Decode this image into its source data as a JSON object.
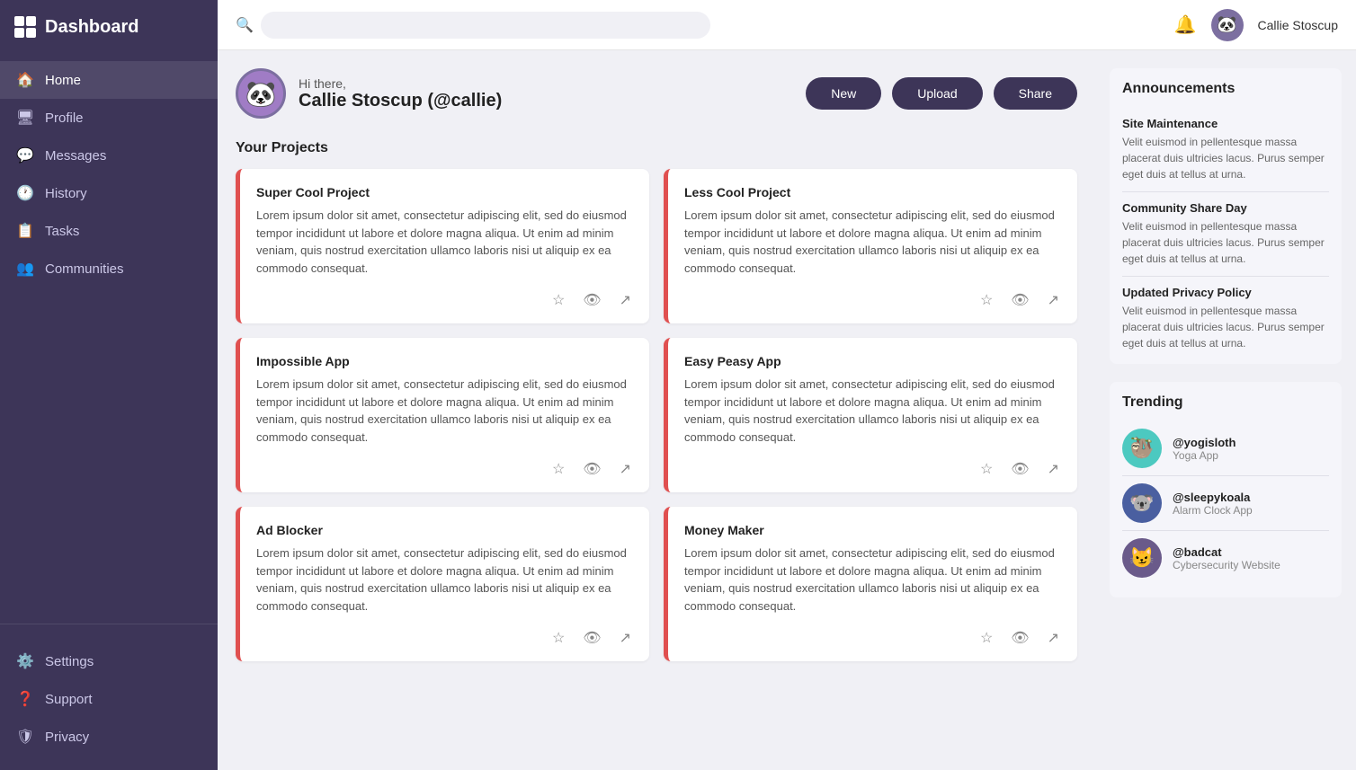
{
  "app": {
    "title": "Dashboard"
  },
  "sidebar": {
    "items_top": [
      {
        "id": "home",
        "label": "Home",
        "icon": "🏠"
      },
      {
        "id": "profile",
        "label": "Profile",
        "icon": "🖥"
      },
      {
        "id": "messages",
        "label": "Messages",
        "icon": "💬"
      },
      {
        "id": "history",
        "label": "History",
        "icon": "🕐"
      },
      {
        "id": "tasks",
        "label": "Tasks",
        "icon": "📋"
      },
      {
        "id": "communities",
        "label": "Communities",
        "icon": "👥"
      }
    ],
    "items_bottom": [
      {
        "id": "settings",
        "label": "Settings",
        "icon": "⚙️"
      },
      {
        "id": "support",
        "label": "Support",
        "icon": "❓"
      },
      {
        "id": "privacy",
        "label": "Privacy",
        "icon": "🛡"
      }
    ]
  },
  "header": {
    "search_placeholder": "",
    "notification_icon": "🔔",
    "user_name": "Callie Stoscup",
    "user_avatar": "🐼"
  },
  "greeting": {
    "hi_text": "Hi there,",
    "user_name": "Callie Stoscup (@callie)",
    "avatar": "🐼",
    "buttons": {
      "new": "New",
      "upload": "Upload",
      "share": "Share"
    }
  },
  "projects": {
    "heading": "Your Projects",
    "cards": [
      {
        "title": "Super Cool Project",
        "description": "Lorem ipsum dolor sit amet, consectetur adipiscing elit, sed do eiusmod tempor incididunt ut labore et dolore magna aliqua. Ut enim ad minim veniam, quis nostrud exercitation ullamco laboris nisi ut aliquip ex ea commodo consequat."
      },
      {
        "title": "Less Cool Project",
        "description": "Lorem ipsum dolor sit amet, consectetur adipiscing elit, sed do eiusmod tempor incididunt ut labore et dolore magna aliqua. Ut enim ad minim veniam, quis nostrud exercitation ullamco laboris nisi ut aliquip ex ea commodo consequat."
      },
      {
        "title": "Impossible App",
        "description": "Lorem ipsum dolor sit amet, consectetur adipiscing elit, sed do eiusmod tempor incididunt ut labore et dolore magna aliqua. Ut enim ad minim veniam, quis nostrud exercitation ullamco laboris nisi ut aliquip ex ea commodo consequat."
      },
      {
        "title": "Easy Peasy App",
        "description": "Lorem ipsum dolor sit amet, consectetur adipiscing elit, sed do eiusmod tempor incididunt ut labore et dolore magna aliqua. Ut enim ad minim veniam, quis nostrud exercitation ullamco laboris nisi ut aliquip ex ea commodo consequat."
      },
      {
        "title": "Ad Blocker",
        "description": "Lorem ipsum dolor sit amet, consectetur adipiscing elit, sed do eiusmod tempor incididunt ut labore et dolore magna aliqua. Ut enim ad minim veniam, quis nostrud exercitation ullamco laboris nisi ut aliquip ex ea commodo consequat."
      },
      {
        "title": "Money Maker",
        "description": "Lorem ipsum dolor sit amet, consectetur adipiscing elit, sed do eiusmod tempor incididunt ut labore et dolore magna aliqua. Ut enim ad minim veniam, quis nostrud exercitation ullamco laboris nisi ut aliquip ex ea commodo consequat."
      }
    ]
  },
  "announcements": {
    "heading": "Announcements",
    "items": [
      {
        "title": "Site Maintenance",
        "text": "Velit euismod in pellentesque massa placerat duis ultricies lacus. Purus semper eget duis at tellus at urna."
      },
      {
        "title": "Community Share Day",
        "text": "Velit euismod in pellentesque massa placerat duis ultricies lacus. Purus semper eget duis at tellus at urna."
      },
      {
        "title": "Updated Privacy Policy",
        "text": "Velit euismod in pellentesque massa placerat duis ultricies lacus. Purus semper eget duis at tellus at urna."
      }
    ]
  },
  "trending": {
    "heading": "Trending",
    "items": [
      {
        "handle": "@yogisloth",
        "app": "Yoga App",
        "avatar": "🦥",
        "bg": "#4cc9c0"
      },
      {
        "handle": "@sleepykoala",
        "app": "Alarm Clock App",
        "avatar": "🐨",
        "bg": "#4a5fa0"
      },
      {
        "handle": "@badcat",
        "app": "Cybersecurity Website",
        "avatar": "😼",
        "bg": "#6a5a8a"
      }
    ]
  }
}
